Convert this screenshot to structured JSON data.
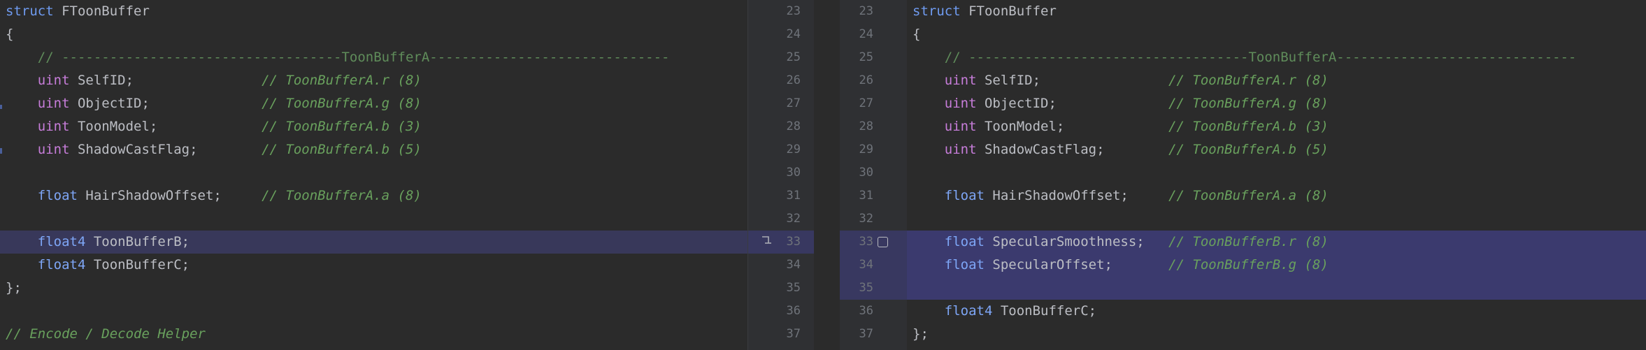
{
  "left": {
    "lines": [
      {
        "n": "23",
        "parts": [
          [
            "kw",
            "struct"
          ],
          [
            "id",
            " FToonBuffer"
          ]
        ]
      },
      {
        "n": "24",
        "parts": [
          [
            "id",
            "{"
          ]
        ]
      },
      {
        "n": "25",
        "parts": [
          [
            "id",
            "    "
          ],
          [
            "cm",
            "// -----------------------------------ToonBufferA------------------------------"
          ]
        ]
      },
      {
        "n": "26",
        "parts": [
          [
            "id",
            "    "
          ],
          [
            "ty",
            "uint"
          ],
          [
            "id",
            " SelfID;                "
          ],
          [
            "cmi",
            "// ToonBufferA.r (8)"
          ]
        ]
      },
      {
        "n": "27",
        "parts": [
          [
            "id",
            "    "
          ],
          [
            "ty",
            "uint"
          ],
          [
            "id",
            " ObjectID;              "
          ],
          [
            "cmi",
            "// ToonBufferA.g (8)"
          ]
        ]
      },
      {
        "n": "28",
        "parts": [
          [
            "id",
            "    "
          ],
          [
            "ty",
            "uint"
          ],
          [
            "id",
            " ToonModel;             "
          ],
          [
            "cmi",
            "// ToonBufferA.b (3)"
          ]
        ]
      },
      {
        "n": "29",
        "parts": [
          [
            "id",
            "    "
          ],
          [
            "ty",
            "uint"
          ],
          [
            "id",
            " ShadowCastFlag;        "
          ],
          [
            "cmi",
            "// ToonBufferA.b (5)"
          ]
        ]
      },
      {
        "n": "30",
        "parts": []
      },
      {
        "n": "31",
        "parts": [
          [
            "id",
            "    "
          ],
          [
            "fl",
            "float"
          ],
          [
            "id",
            " HairShadowOffset;     "
          ],
          [
            "cmi",
            "// ToonBufferA.a (8)"
          ]
        ]
      },
      {
        "n": "32",
        "parts": []
      },
      {
        "n": "33",
        "parts": [
          [
            "id",
            "    "
          ],
          [
            "fl",
            "float4"
          ],
          [
            "id",
            " ToonBufferB;"
          ]
        ],
        "highlight": true
      },
      {
        "n": "34",
        "parts": [
          [
            "id",
            "    "
          ],
          [
            "fl",
            "float4"
          ],
          [
            "id",
            " ToonBufferC;"
          ]
        ]
      },
      {
        "n": "35",
        "parts": [
          [
            "id",
            "};"
          ]
        ]
      },
      {
        "n": "36",
        "parts": []
      },
      {
        "n": "37",
        "parts": [
          [
            "cmi",
            "// Encode / Decode Helper"
          ]
        ]
      }
    ]
  },
  "right": {
    "lines": [
      {
        "n": "23",
        "parts": [
          [
            "kw",
            "struct"
          ],
          [
            "id",
            " FToonBuffer"
          ]
        ]
      },
      {
        "n": "24",
        "parts": [
          [
            "id",
            "{"
          ]
        ]
      },
      {
        "n": "25",
        "parts": [
          [
            "id",
            "    "
          ],
          [
            "cm",
            "// -----------------------------------ToonBufferA------------------------------"
          ]
        ]
      },
      {
        "n": "26",
        "parts": [
          [
            "id",
            "    "
          ],
          [
            "ty",
            "uint"
          ],
          [
            "id",
            " SelfID;                "
          ],
          [
            "cmi",
            "// ToonBufferA.r (8)"
          ]
        ]
      },
      {
        "n": "27",
        "parts": [
          [
            "id",
            "    "
          ],
          [
            "ty",
            "uint"
          ],
          [
            "id",
            " ObjectID;              "
          ],
          [
            "cmi",
            "// ToonBufferA.g (8)"
          ]
        ]
      },
      {
        "n": "28",
        "parts": [
          [
            "id",
            "    "
          ],
          [
            "ty",
            "uint"
          ],
          [
            "id",
            " ToonModel;             "
          ],
          [
            "cmi",
            "// ToonBufferA.b (3)"
          ]
        ]
      },
      {
        "n": "29",
        "parts": [
          [
            "id",
            "    "
          ],
          [
            "ty",
            "uint"
          ],
          [
            "id",
            " ShadowCastFlag;        "
          ],
          [
            "cmi",
            "// ToonBufferA.b (5)"
          ]
        ]
      },
      {
        "n": "30",
        "parts": []
      },
      {
        "n": "31",
        "parts": [
          [
            "id",
            "    "
          ],
          [
            "fl",
            "float"
          ],
          [
            "id",
            " HairShadowOffset;     "
          ],
          [
            "cmi",
            "// ToonBufferA.a (8)"
          ]
        ]
      },
      {
        "n": "32",
        "parts": []
      },
      {
        "n": "33",
        "parts": [
          [
            "id",
            "    "
          ],
          [
            "fl",
            "float"
          ],
          [
            "id",
            " SpecularSmoothness;   "
          ],
          [
            "cmi",
            "// ToonBufferB.r (8)"
          ]
        ],
        "highlight": true
      },
      {
        "n": "34",
        "parts": [
          [
            "id",
            "    "
          ],
          [
            "fl",
            "float"
          ],
          [
            "id",
            " SpecularOffset;       "
          ],
          [
            "cmi",
            "// ToonBufferB.g (8)"
          ]
        ],
        "highlight": true
      },
      {
        "n": "35",
        "parts": [],
        "highlight": true
      },
      {
        "n": "36",
        "parts": [
          [
            "id",
            "    "
          ],
          [
            "fl",
            "float4"
          ],
          [
            "id",
            " ToonBufferC;"
          ]
        ]
      },
      {
        "n": "37",
        "parts": [
          [
            "id",
            "};"
          ]
        ]
      }
    ]
  },
  "gutter": {
    "left_icon": "apply-change-icon",
    "right_icon": "checkbox-icon"
  }
}
